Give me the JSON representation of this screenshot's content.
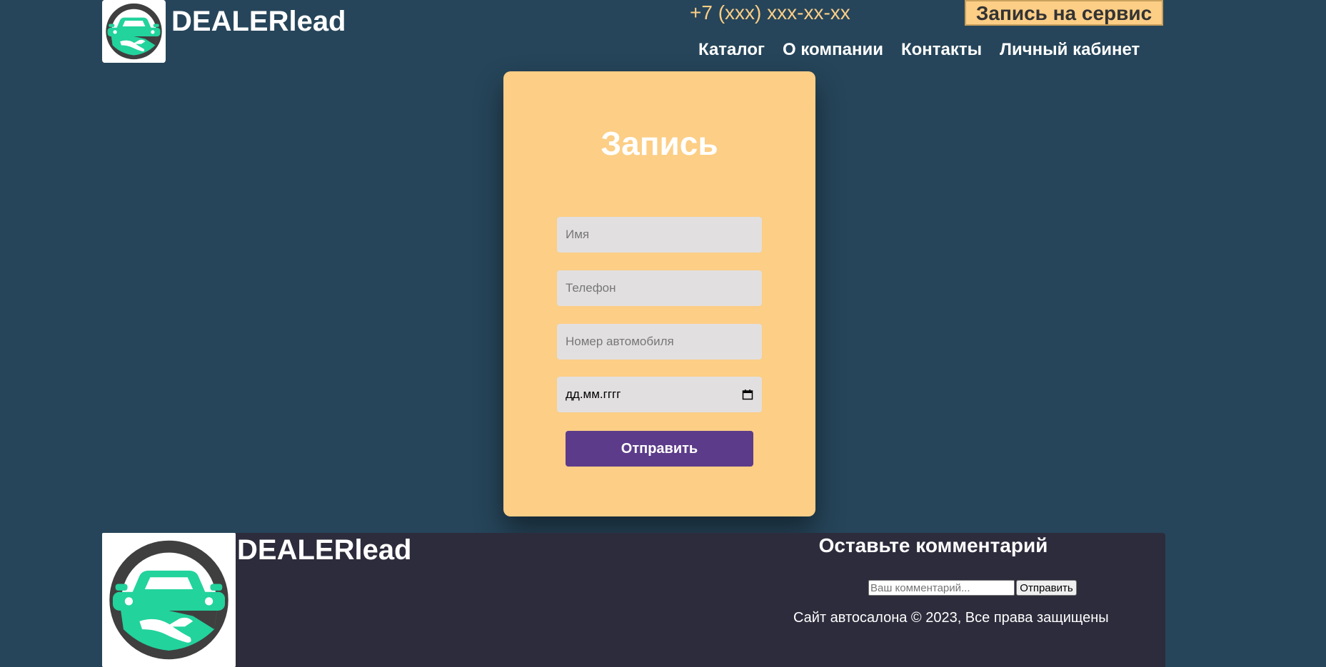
{
  "header": {
    "brand": "DEALERlead",
    "phone": "+7 (xxx) xxx-xx-xx",
    "cta_label": "Запись на сервис",
    "nav": [
      {
        "label": "Каталог"
      },
      {
        "label": "О компании"
      },
      {
        "label": "Контакты"
      },
      {
        "label": "Личный кабинет"
      }
    ]
  },
  "form": {
    "title": "Запись",
    "name_placeholder": "Имя",
    "phone_placeholder": "Телефон",
    "car_number_placeholder": "Номер автомобиля",
    "date_placeholder": "дд.мм.гггг",
    "submit_label": "Отправить"
  },
  "footer": {
    "brand": "DEALERlead",
    "heading": "Оставьте комментарий",
    "comment_placeholder": "Ваш комментарий...",
    "comment_submit_label": "Отправить",
    "copyright": "Сайт автосалона © 2023, Все права защищены"
  },
  "colors": {
    "background": "#26455a",
    "accent": "#fcce86",
    "button": "#5c3b8a",
    "footer": "#2d2c3c",
    "logo_green": "#22d39c",
    "logo_dark": "#3f3f3f"
  },
  "icons": {
    "logo": "car-handshake-logo-icon",
    "calendar": "calendar-icon"
  }
}
